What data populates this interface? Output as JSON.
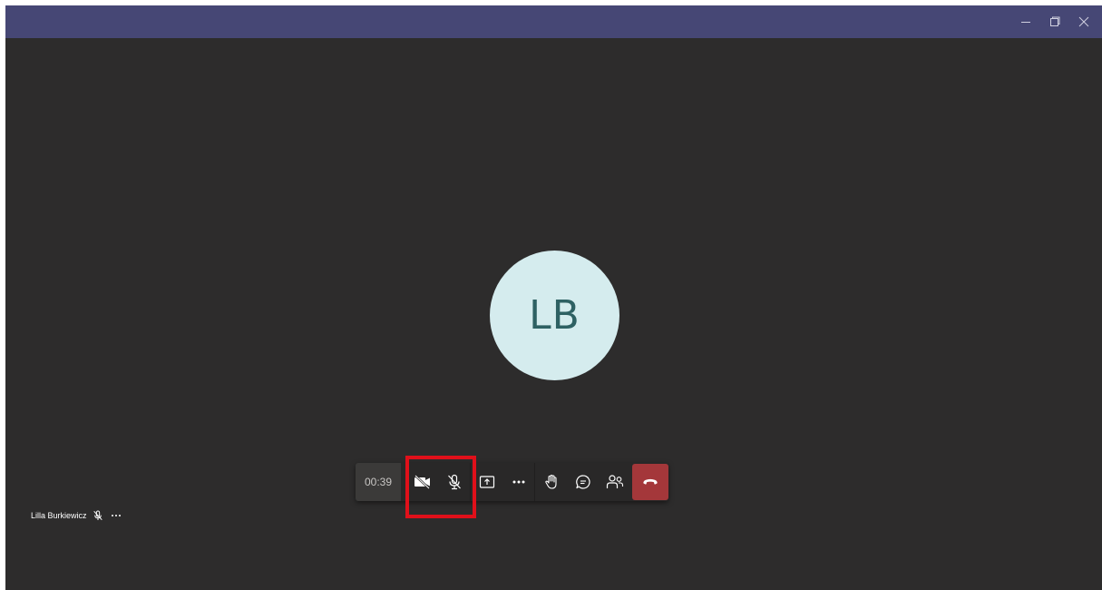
{
  "window": {
    "titlebar_color": "#464775",
    "controls": [
      {
        "name": "minimize-icon"
      },
      {
        "name": "restore-icon"
      },
      {
        "name": "close-icon"
      }
    ]
  },
  "avatar": {
    "initials": "LB",
    "background": "#d5ecee",
    "text_color": "#2e6163"
  },
  "call_controls": {
    "timer": "00:39",
    "buttons": [
      {
        "name": "camera-off-icon",
        "state": "off"
      },
      {
        "name": "mic-off-icon",
        "state": "muted"
      },
      {
        "name": "share-screen-icon"
      },
      {
        "name": "more-actions-icon"
      },
      {
        "name": "raise-hand-icon"
      },
      {
        "name": "chat-icon"
      },
      {
        "name": "participants-icon"
      },
      {
        "name": "hang-up-icon",
        "color": "#a4373a"
      }
    ],
    "highlight_color": "#e0101a"
  },
  "participant": {
    "name": "Lilla Burkiewicz",
    "mic": "mic-off-icon",
    "more": "more-icon"
  }
}
